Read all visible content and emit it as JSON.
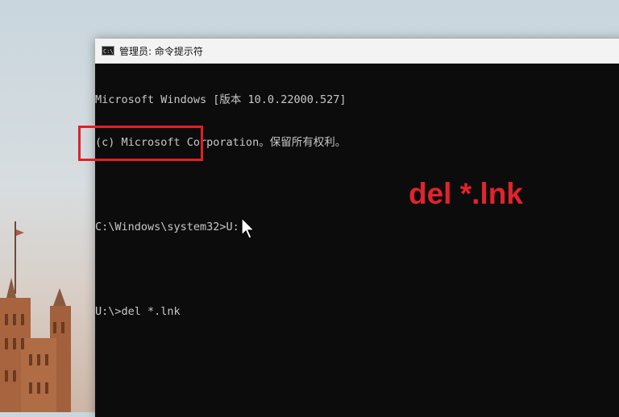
{
  "window": {
    "icon_text": "C:\\",
    "title": "管理员: 命令提示符"
  },
  "console": {
    "lines": [
      "Microsoft Windows [版本 10.0.22000.527]",
      "(c) Microsoft Corporation。保留所有权利。",
      "",
      "C:\\Windows\\system32>U:",
      "",
      "U:\\>del *.lnk"
    ]
  },
  "annotation": {
    "text": "del *.lnk",
    "color": "#e3232b"
  },
  "colors": {
    "console_bg": "#0c0c0c",
    "console_fg": "#c8c8c8",
    "highlight": "#e02027"
  }
}
